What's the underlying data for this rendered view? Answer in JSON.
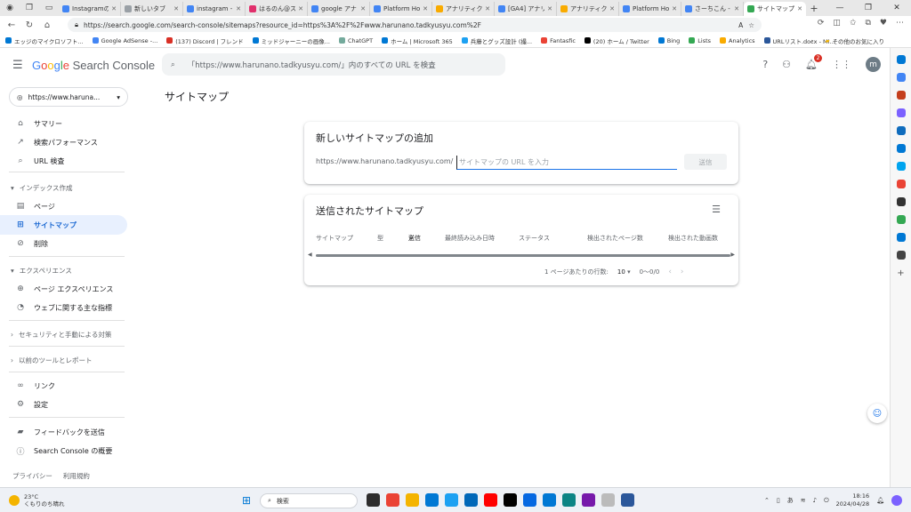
{
  "browser": {
    "tabs": [
      {
        "title": "Instagramの",
        "color": "#4285f4"
      },
      {
        "title": "新しいタブ",
        "color": "#9aa0a6"
      },
      {
        "title": "instagram -",
        "color": "#4285f4"
      },
      {
        "title": "はるのん@ス",
        "color": "#e1306c"
      },
      {
        "title": "google アナ",
        "color": "#4285f4"
      },
      {
        "title": "Platform Ho",
        "color": "#4285f4"
      },
      {
        "title": "アナリティクス",
        "color": "#f9ab00"
      },
      {
        "title": "[GA4] アナリ",
        "color": "#4285f4"
      },
      {
        "title": "アナリティクス",
        "color": "#f9ab00"
      },
      {
        "title": "Platform Ho",
        "color": "#4285f4"
      },
      {
        "title": "さーちこん -",
        "color": "#4285f4"
      },
      {
        "title": "サイトマップ",
        "color": "#34a853"
      }
    ],
    "new_tab": "+",
    "url": "https://search.google.com/search-console/sitemaps?resource_id=https%3A%2F%2Fwww.harunano.tadkyusyu.com%2F",
    "bookmarks": [
      {
        "label": "エッジのマイクロソフト...",
        "color": "#0078d4"
      },
      {
        "label": "Google AdSense -...",
        "color": "#4285f4"
      },
      {
        "label": "(137) Discord | フレンド",
        "color": "#d93025"
      },
      {
        "label": "ミッドジャーニーの画像...",
        "color": "#0078d4"
      },
      {
        "label": "ChatGPT",
        "color": "#74aa9c"
      },
      {
        "label": "ホーム | Microsoft 365",
        "color": "#0078d4"
      },
      {
        "label": "兵藤とグッズ設計 (撮...",
        "color": "#1da1f2"
      },
      {
        "label": "Fantasfic",
        "color": "#ea4335"
      },
      {
        "label": "(20) ホーム / Twitter",
        "color": "#000000"
      },
      {
        "label": "Bing",
        "color": "#0078d4"
      },
      {
        "label": "Lists",
        "color": "#34a853"
      },
      {
        "label": "Analytics",
        "color": "#f9ab00"
      },
      {
        "label": "URLリスト.docx - Mi...",
        "color": "#2b579a"
      }
    ],
    "bookmark_folder": "その他のお気に入り"
  },
  "header": {
    "product": "Search Console",
    "search_placeholder": "「https://www.harunano.tadkyusyu.com/」内のすべての URL を検査",
    "notification_count": "2",
    "avatar_letter": "m"
  },
  "sidebar": {
    "property": "https://www.haruna...",
    "items_top": [
      {
        "label": "サマリー",
        "icon": "⌂"
      },
      {
        "label": "検索パフォーマンス",
        "icon": "↗"
      },
      {
        "label": "URL 検査",
        "icon": "⌕"
      }
    ],
    "section_index": "インデックス作成",
    "items_index": [
      {
        "label": "ページ",
        "icon": "▤"
      },
      {
        "label": "サイトマップ",
        "icon": "⊞"
      },
      {
        "label": "削除",
        "icon": "⊘"
      }
    ],
    "section_experience": "エクスペリエンス",
    "items_experience": [
      {
        "label": "ページ エクスペリエンス",
        "icon": "⊕"
      },
      {
        "label": "ウェブに関する主な指標",
        "icon": "◔"
      }
    ],
    "section_security": "セキュリティと手動による対策",
    "section_legacy": "以前のツールとレポート",
    "items_bottom": [
      {
        "label": "リンク",
        "icon": "∞"
      },
      {
        "label": "設定",
        "icon": "⚙"
      }
    ],
    "items_feedback": [
      {
        "label": "フィードバックを送信",
        "icon": "▰"
      },
      {
        "label": "Search Console の概要",
        "icon": "ⓘ"
      }
    ],
    "footer_privacy": "プライバシー",
    "footer_terms": "利用規約"
  },
  "main": {
    "page_title": "サイトマップ",
    "add_card": {
      "title": "新しいサイトマップの追加",
      "prefix": "https://www.harunano.tadkyusyu.com/",
      "placeholder": "サイトマップの URL を入力",
      "submit": "送信"
    },
    "submitted_card": {
      "title": "送信されたサイトマップ",
      "columns": [
        "サイトマップ",
        "型",
        "送信",
        "最終読み込み日時",
        "ステータス",
        "検出されたページ数",
        "検出された動画数"
      ],
      "sort_indicator": "↓",
      "rows_per_page_label": "1 ページあたりの行数:",
      "rows_per_page": "10",
      "range": "0〜0/0"
    }
  },
  "taskbar": {
    "temp": "23°C",
    "weather": "くもりのち晴れ",
    "search": "検索",
    "time": "18:16",
    "date": "2024/04/28"
  }
}
